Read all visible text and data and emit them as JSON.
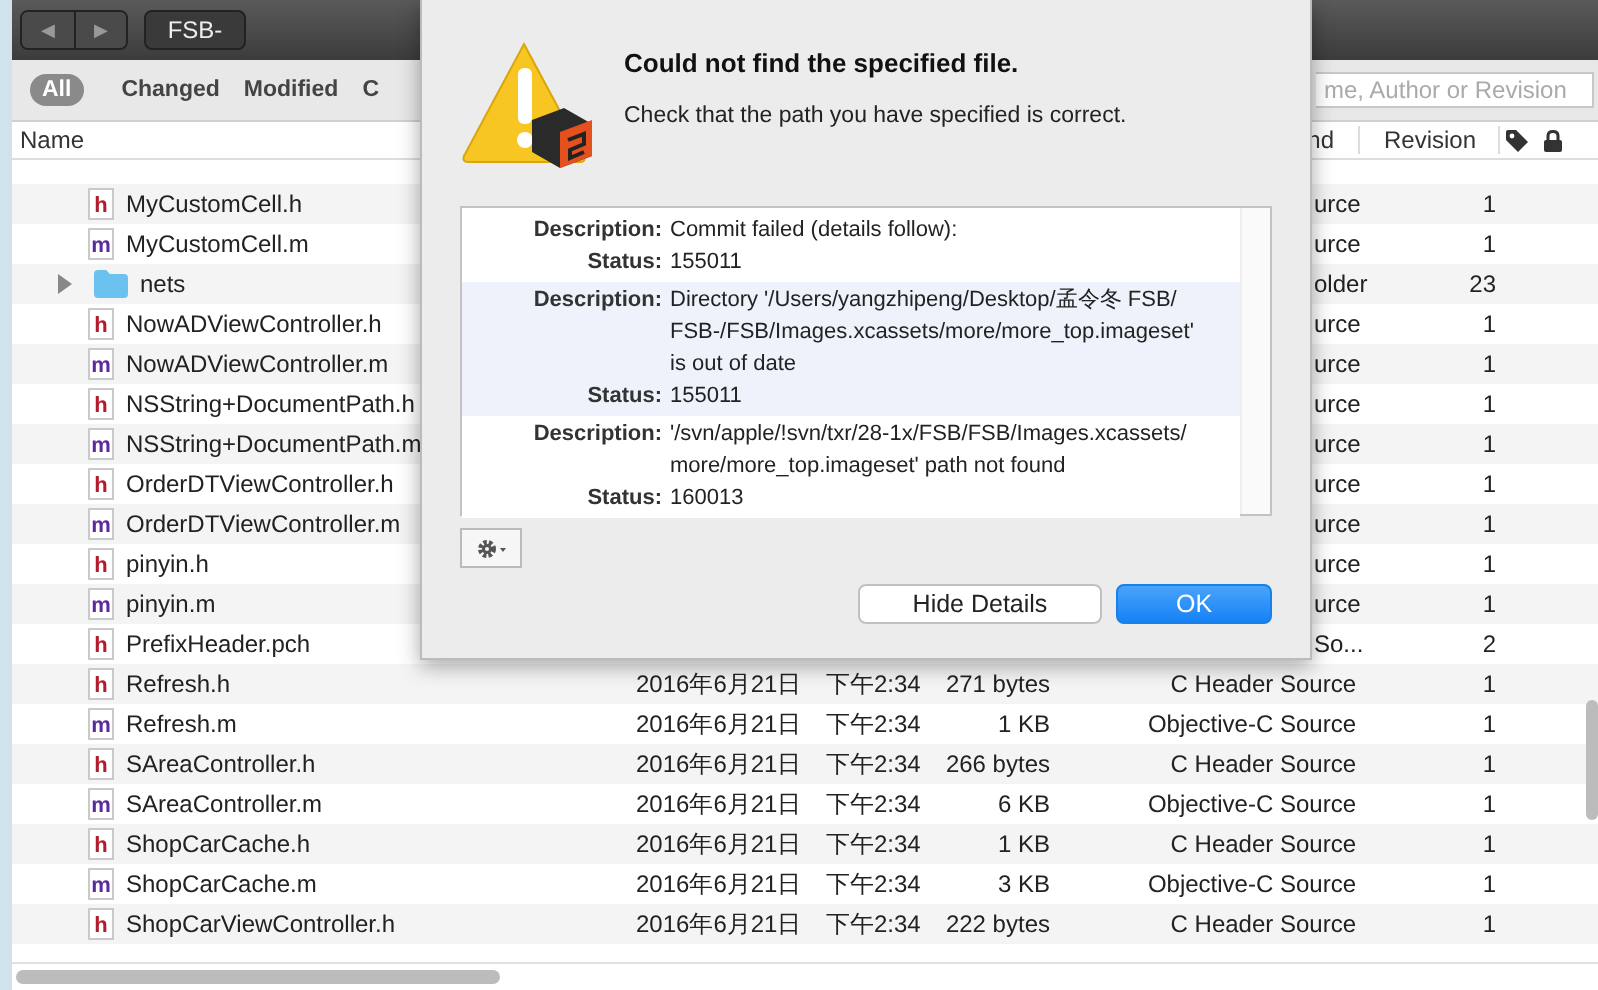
{
  "toolbar": {
    "nav": [
      "◀",
      "▶"
    ],
    "path": "FSB-"
  },
  "filters": [
    {
      "label": "All",
      "selected": true
    },
    {
      "label": "Changed",
      "selected": false
    },
    {
      "label": "Modified",
      "selected": false
    },
    {
      "label": "C",
      "selected": false
    }
  ],
  "search": {
    "placeholder": "me, Author or Revision"
  },
  "table": {
    "columns": [
      "Name",
      "nd",
      "Revision"
    ],
    "rows": [
      {
        "kind": "file",
        "badge": "h",
        "name": "MyCustomCell.h",
        "type": "urce",
        "revision": "1"
      },
      {
        "kind": "file",
        "badge": "m",
        "name": "MyCustomCell.m",
        "type": "urce",
        "revision": "1"
      },
      {
        "kind": "folder",
        "expanded": false,
        "name": "nets",
        "type": "older",
        "revision": "23"
      },
      {
        "kind": "file",
        "badge": "h",
        "name": "NowADViewController.h",
        "type": "urce",
        "revision": "1"
      },
      {
        "kind": "file",
        "badge": "m",
        "name": "NowADViewController.m",
        "type": "urce",
        "revision": "1"
      },
      {
        "kind": "file",
        "badge": "h",
        "name": "NSString+DocumentPath.h",
        "type": "urce",
        "revision": "1"
      },
      {
        "kind": "file",
        "badge": "m",
        "name": "NSString+DocumentPath.m",
        "type": "urce",
        "revision": "1"
      },
      {
        "kind": "file",
        "badge": "h",
        "name": "OrderDTViewController.h",
        "type": "urce",
        "revision": "1"
      },
      {
        "kind": "file",
        "badge": "m",
        "name": "OrderDTViewController.m",
        "type": "urce",
        "revision": "1"
      },
      {
        "kind": "file",
        "badge": "h",
        "name": "pinyin.h",
        "type": "urce",
        "revision": "1"
      },
      {
        "kind": "file",
        "badge": "m",
        "name": "pinyin.m",
        "type": "urce",
        "revision": "1"
      },
      {
        "kind": "file",
        "badge": "h",
        "name": "PrefixHeader.pch",
        "type": "So...",
        "revision": "2"
      },
      {
        "kind": "file",
        "badge": "h",
        "name": "Refresh.h",
        "date": "2016年6月21日",
        "time": "下午2:34",
        "size": "271 bytes",
        "type": "C Header Source",
        "revision": "1"
      },
      {
        "kind": "file",
        "badge": "m",
        "name": "Refresh.m",
        "date": "2016年6月21日",
        "time": "下午2:34",
        "size": "1 KB",
        "type": "Objective-C Source",
        "revision": "1"
      },
      {
        "kind": "file",
        "badge": "h",
        "name": "SAreaController.h",
        "date": "2016年6月21日",
        "time": "下午2:34",
        "size": "266 bytes",
        "type": "C Header Source",
        "revision": "1"
      },
      {
        "kind": "file",
        "badge": "m",
        "name": "SAreaController.m",
        "date": "2016年6月21日",
        "time": "下午2:34",
        "size": "6 KB",
        "type": "Objective-C Source",
        "revision": "1"
      },
      {
        "kind": "file",
        "badge": "h",
        "name": "ShopCarCache.h",
        "date": "2016年6月21日",
        "time": "下午2:34",
        "size": "1 KB",
        "type": "C Header Source",
        "revision": "1"
      },
      {
        "kind": "file",
        "badge": "m",
        "name": "ShopCarCache.m",
        "date": "2016年6月21日",
        "time": "下午2:34",
        "size": "3 KB",
        "type": "Objective-C Source",
        "revision": "1"
      },
      {
        "kind": "file",
        "badge": "h",
        "name": "ShopCarViewController.h",
        "date": "2016年6月21日",
        "time": "下午2:34",
        "size": "222 bytes",
        "type": "C Header Source",
        "revision": "1"
      }
    ]
  },
  "dialog": {
    "title": "Could not find the specified file.",
    "message": "Check that the path you have specified is correct.",
    "details": [
      {
        "selected": false,
        "entries": [
          {
            "label": "Description:",
            "lines": [
              "Commit failed (details follow):"
            ]
          },
          {
            "label": "Status:",
            "lines": [
              "155011"
            ]
          }
        ]
      },
      {
        "selected": true,
        "entries": [
          {
            "label": "Description:",
            "lines": [
              "Directory '/Users/yangzhipeng/Desktop/孟令冬   FSB/",
              "FSB-/FSB/Images.xcassets/more/more_top.imageset'",
              "is out of date"
            ]
          },
          {
            "label": "Status:",
            "lines": [
              "155011"
            ]
          }
        ]
      },
      {
        "selected": false,
        "entries": [
          {
            "label": "Description:",
            "lines": [
              "'/svn/apple/!svn/txr/28-1x/FSB/FSB/Images.xcassets/",
              "more/more_top.imageset' path not found"
            ]
          },
          {
            "label": "Status:",
            "lines": [
              "160013"
            ]
          }
        ]
      }
    ],
    "buttons": [
      {
        "label": "Hide Details",
        "primary": false
      },
      {
        "label": "OK",
        "primary": true
      }
    ]
  }
}
